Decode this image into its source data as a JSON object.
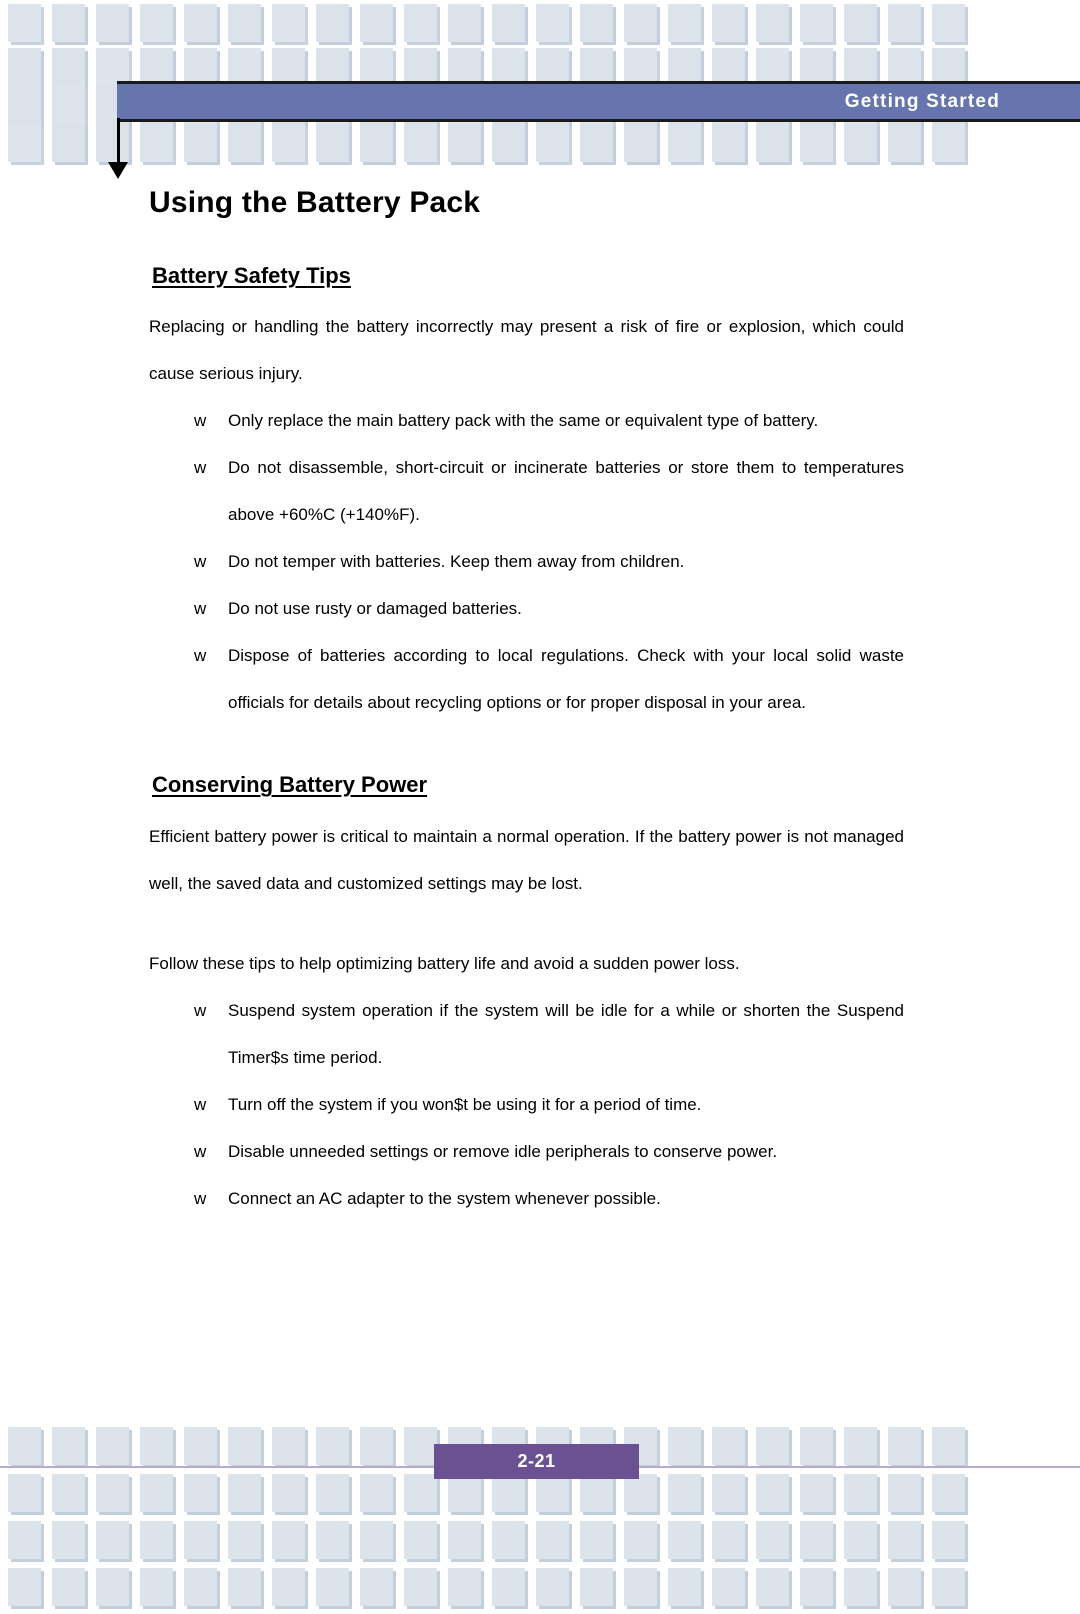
{
  "header": {
    "banner_label": "Getting  Started"
  },
  "document": {
    "title": "Using the Battery Pack",
    "sections": [
      {
        "heading": "Battery Safety Tips",
        "intro": "Replacing or handling the battery incorrectly may present a risk of fire or explosion, which could cause serious injury.",
        "bullet_marker": "w",
        "bullets": [
          "Only replace the main battery pack with the same or equivalent type of battery.",
          "Do not disassemble, short-circuit or incinerate batteries or store them to temperatures above +60%C (+140%F).",
          "Do not temper with batteries.   Keep them away from children.",
          "Do not use rusty or damaged batteries.",
          "Dispose of batteries according to local regulations.   Check with your local solid waste officials for details about recycling options or for proper disposal in your area."
        ]
      },
      {
        "heading": "Conserving Battery Power",
        "intro": "Efficient battery power is critical to maintain a normal operation.   If the battery power is not managed well, the saved data and customized settings may be lost.",
        "intro2": "Follow these tips to help optimizing battery life and avoid a sudden power loss.",
        "bullet_marker": "w",
        "bullets": [
          "Suspend system operation if the system will be idle for a while or shorten the Suspend Timer$s time period.",
          "Turn off the system if you won$t be using it for a period of time.",
          "Disable unneeded settings or remove idle peripherals to conserve power.",
          "Connect an AC adapter to the system whenever possible."
        ]
      }
    ]
  },
  "footer": {
    "page_number": "2-21"
  },
  "colors": {
    "banner": "#6675ad",
    "page_number_box": "#6b5192",
    "pattern_square": "#dbe2ea",
    "pattern_shadow": "#c3cedd",
    "footer_rule": "#b9a9cc"
  }
}
